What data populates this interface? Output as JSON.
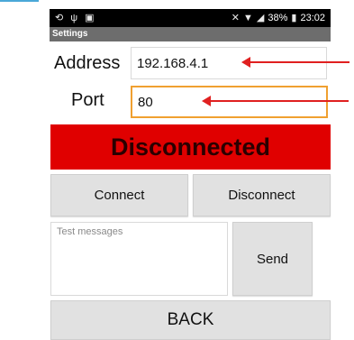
{
  "status_bar": {
    "battery": "38%",
    "time": "23:02",
    "icons": [
      "sync-icon",
      "usb-icon",
      "notification-icon",
      "mute-icon",
      "wifi-icon",
      "signal-icon",
      "battery-icon"
    ]
  },
  "appbar": {
    "title": "Settings"
  },
  "form": {
    "address_label": "Address",
    "address_value": "192.168.4.1",
    "port_label": "Port",
    "port_value": "80"
  },
  "connection": {
    "status": "Disconnected",
    "status_color": "#e00000"
  },
  "buttons": {
    "connect": "Connect",
    "disconnect": "Disconnect",
    "send": "Send",
    "back": "BACK"
  },
  "messages": {
    "placeholder": "Test messages"
  },
  "colors": {
    "accent_focus": "#f0a030",
    "annotation_arrow": "#e02020"
  }
}
